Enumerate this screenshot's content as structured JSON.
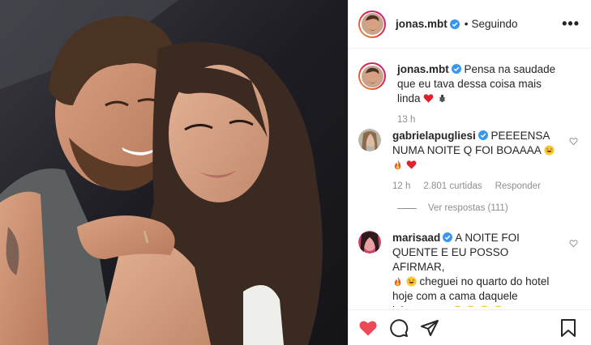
{
  "post": {
    "author": "jonas.mbt",
    "header_separator": "•",
    "follow_status": "Seguindo",
    "more_icon": "•••"
  },
  "caption": {
    "username": "jonas.mbt",
    "text": "Pensa na saudade que eu tava dessa coisa mais linda",
    "time": "13 h"
  },
  "comments": [
    {
      "username": "gabrielapugliesi",
      "text": "PEEEENSA NUMA NOITE Q FOI BOAAAA",
      "time": "12 h",
      "likes": "2.801 curtidas",
      "reply": "Responder"
    },
    {
      "username": "marisaad",
      "text_1": "A NOITE FOI QUENTE E EU POSSO AFIRMAR,",
      "text_2": "cheguei no quarto do hotel hoje com a cama daquele jeitooooooo"
    }
  ],
  "view_replies": "Ver respostas (111)",
  "colors": {
    "like_red": "#ed4956",
    "verified_blue": "#3897f0",
    "muted": "#8e8e8e"
  },
  "icons": [
    "verified-badge-icon",
    "heart-icon",
    "comment-icon",
    "share-icon",
    "bookmark-icon",
    "more-options-icon"
  ]
}
